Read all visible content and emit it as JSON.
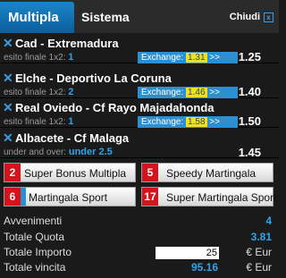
{
  "tabs": {
    "multipla": "Multipla",
    "sistema": "Sistema",
    "close": "Chiudi",
    "close_icon": "x"
  },
  "bets": [
    {
      "match": "Cad - Extremadura",
      "sel_label": "esito finale 1x2:",
      "pick": "1",
      "exchange_label": "Exchange:",
      "exchange_value": "1.31",
      "exchange_arrow": ">>",
      "odd": "1.25"
    },
    {
      "match": "Elche - Deportivo La Coruna",
      "sel_label": "esito finale 1x2:",
      "pick": "2",
      "exchange_label": "Exchange:",
      "exchange_value": "1.46",
      "exchange_arrow": ">>",
      "odd": "1.40"
    },
    {
      "match": "Real Oviedo - Cf Rayo Majadahonda",
      "sel_label": "esito finale 1x2:",
      "pick": "1",
      "exchange_label": "Exchange:",
      "exchange_value": "1.58",
      "exchange_arrow": ">>",
      "odd": "1.50"
    },
    {
      "match": "Albacete - Cf Malaga",
      "sel_label": "under and over:",
      "pick": "under 2.5",
      "odd": "1.45"
    }
  ],
  "promos": [
    {
      "badge": "2",
      "label": "Super Bonus Multipla"
    },
    {
      "badge": "5",
      "label": "Speedy Martingala"
    },
    {
      "badge": "6",
      "label": "Martingala Sport"
    },
    {
      "badge": "17",
      "label": "Super Martingala Sport"
    }
  ],
  "summary": {
    "avvenimenti_label": "Avvenimenti",
    "avvenimenti_value": "4",
    "quota_label": "Totale Quota",
    "quota_value": "3.81",
    "importo_label": "Totale Importo",
    "importo_value": "25",
    "importo_currency": "€ Eur",
    "vincita_label": "Totale vincita",
    "vincita_value": "95.16",
    "vincita_currency": "€ Eur"
  },
  "colors": {
    "accent": "#2fa3e8",
    "exchange_bg": "#2b8fd1",
    "exchange_value_bg": "#f0e020",
    "badge": "#d4141c"
  }
}
